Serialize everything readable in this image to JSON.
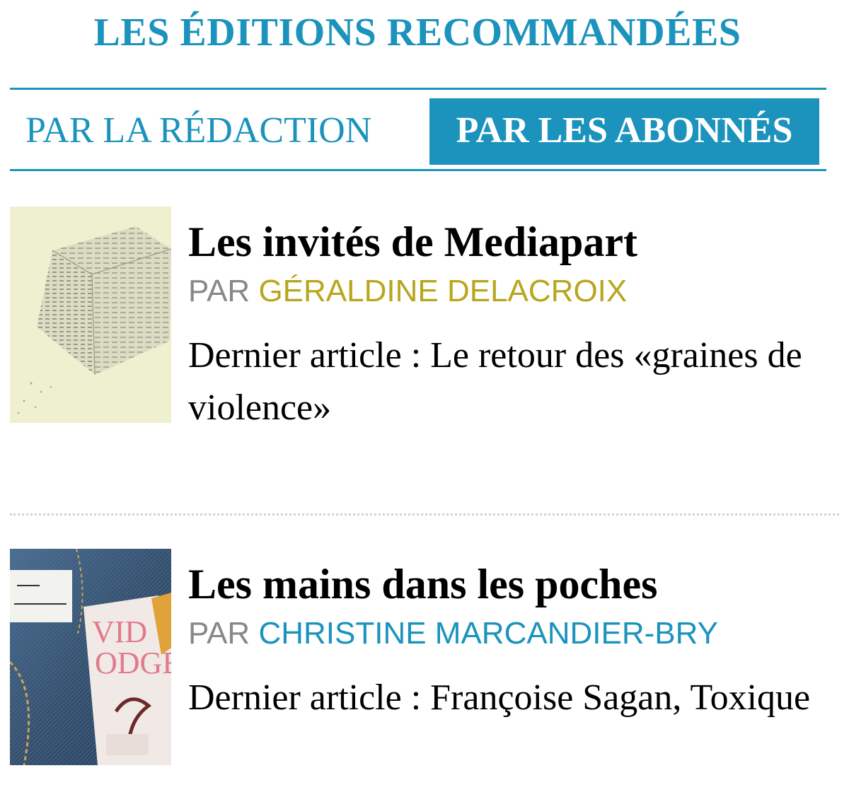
{
  "section": {
    "title": "LES ÉDITIONS RECOMMANDÉES"
  },
  "tabs": [
    {
      "label": "PAR LA RÉDACTION",
      "active": false
    },
    {
      "label": "PAR LES ABONNÉS",
      "active": true
    }
  ],
  "editions": [
    {
      "title": "Les invités de Mediapart",
      "by_label": "PAR",
      "author": "GÉRALDINE DELACROIX",
      "author_color": "#b8a61e",
      "excerpt": "Dernier article : Le retour des «graines de violence»"
    },
    {
      "title": "Les mains dans les poches",
      "by_label": "PAR",
      "author": "CHRISTINE MARCANDIER-BRY",
      "author_color": "#1b93bc",
      "excerpt": "Dernier article : Françoise Sagan, Toxique"
    }
  ],
  "colors": {
    "accent": "#1b93bc",
    "active_tab_text": "#ffffff",
    "muted": "#888888",
    "divider": "#d2d2d2"
  }
}
